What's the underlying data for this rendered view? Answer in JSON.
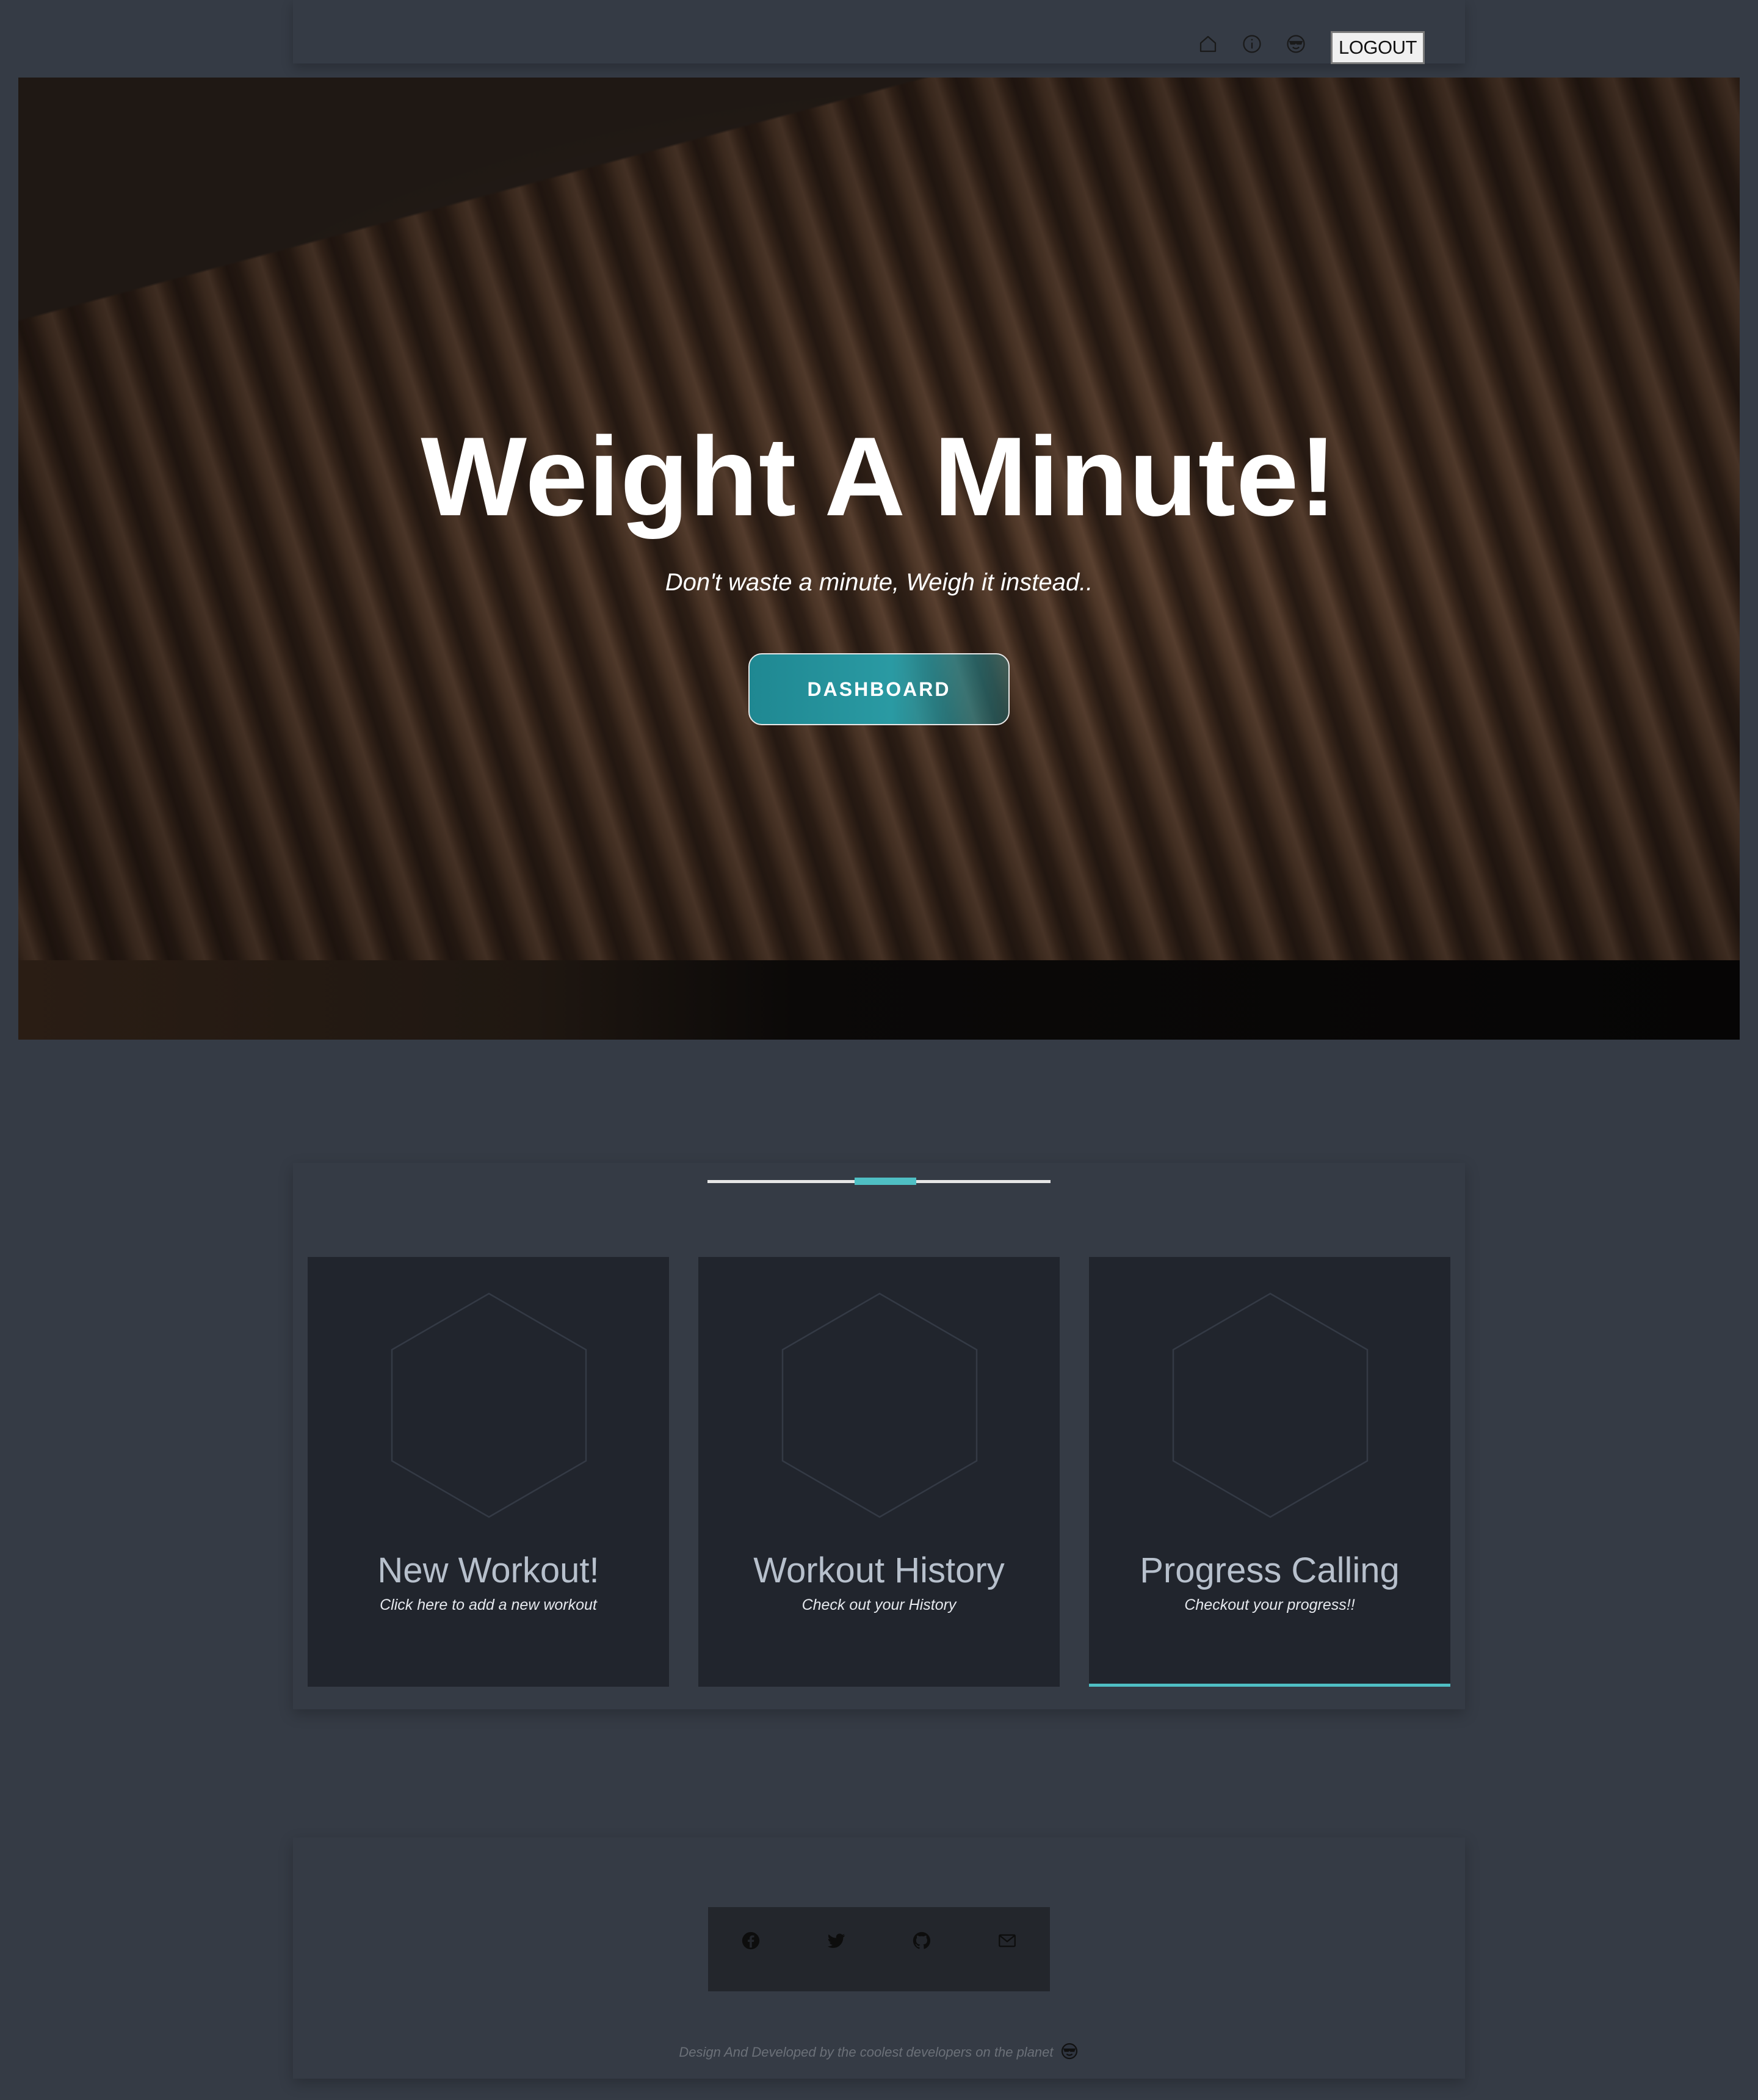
{
  "nav": {
    "icons": [
      "home-icon",
      "info-icon",
      "cool-face-icon"
    ],
    "logout_label": "LOGOUT"
  },
  "hero": {
    "title": "Weight A Minute!",
    "subtitle": "Don't waste a minute, Weigh it instead..",
    "button_label": "DASHBOARD"
  },
  "colors": {
    "accent": "#4fbfc4",
    "background": "#353b45",
    "card": "#21252d",
    "button": "#2a9aa3"
  },
  "cards": [
    {
      "title": "New Workout!",
      "subtitle": "Click here to add a new workout",
      "icon": "hexagon-icon"
    },
    {
      "title": "Workout History",
      "subtitle": "Check out your History",
      "icon": "hexagon-icon"
    },
    {
      "title": "Progress Calling",
      "subtitle": "Checkout your progress!!",
      "icon": "hexagon-icon"
    }
  ],
  "footer": {
    "social_icons": [
      "facebook-icon",
      "twitter-icon",
      "github-icon",
      "mail-icon"
    ],
    "credit": "Design And Developed by the coolest developers on the planet"
  }
}
